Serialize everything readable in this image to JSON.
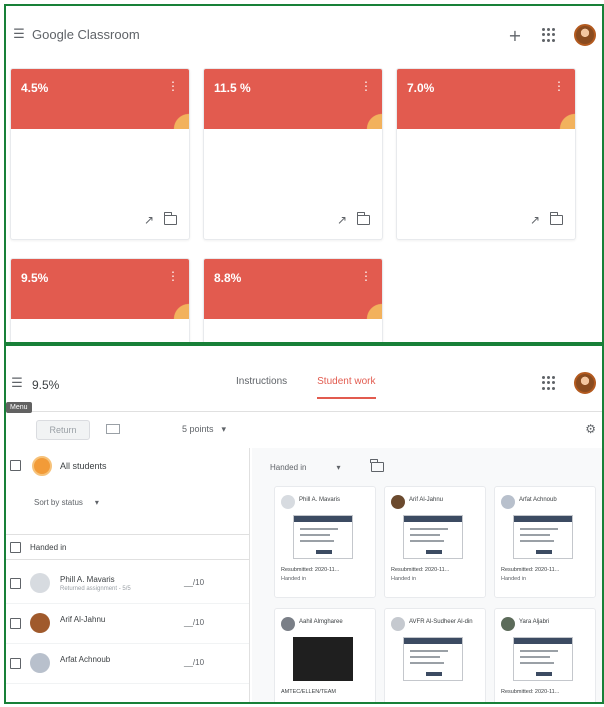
{
  "top": {
    "brand": "Google Classroom",
    "icons": {
      "menu": "menu-icon",
      "add": "plus-icon",
      "apps": "apps-icon"
    },
    "cards": [
      {
        "title": "4.5%",
        "more": "⋮"
      },
      {
        "title": "11.5 %",
        "more": "⋮"
      },
      {
        "title": "7.0%",
        "more": "⋮"
      },
      {
        "title": "9.5%",
        "more": "⋮"
      },
      {
        "title": "8.8%",
        "more": "⋮"
      }
    ]
  },
  "bottom": {
    "class_name": "9.5%",
    "tooltip": "Menu",
    "tabs": [
      {
        "label": "Instructions",
        "active": false
      },
      {
        "label": "Student work",
        "active": true
      }
    ],
    "toolbar": {
      "return_label": "Return",
      "points_label": "5 points",
      "points_caret": "▾"
    },
    "list": {
      "all_students": "All students",
      "sort_label": "Sort by status",
      "sort_caret": "▾",
      "group_label": "Handed in",
      "students": [
        {
          "name": "Phill A. Mavaris",
          "sub": "Returned assignment - 5/5",
          "grade": "__/10"
        },
        {
          "name": "Arif Al-Jahnu",
          "sub": "",
          "grade": "__/10"
        },
        {
          "name": "Arfat Achnoub",
          "sub": "",
          "grade": "__/10"
        }
      ]
    },
    "work": {
      "filter_label": "Handed in",
      "filter_caret": "▾",
      "cards": [
        {
          "name": "Phill A. Mavaris",
          "status": "Resubmitted: 2020-11...",
          "sub": "Handed in",
          "thumb": "form"
        },
        {
          "name": "Arif Al-Jahnu",
          "status": "Resubmitted: 2020-11...",
          "sub": "Handed in",
          "thumb": "form"
        },
        {
          "name": "Arfat Achnoub",
          "status": "Resubmitted: 2020-11...",
          "sub": "Handed in",
          "thumb": "form"
        },
        {
          "name": "Aahil Almgharee",
          "status": "AMTEC/ELLEN/TEAM",
          "sub": "",
          "thumb": "dark"
        },
        {
          "name": "AVFR Al-Sudheer Al-din",
          "status": "",
          "sub": "",
          "thumb": "form"
        },
        {
          "name": "Yara Aljabri",
          "status": "Resubmitted: 2020-11...",
          "sub": "",
          "thumb": "form"
        }
      ]
    }
  },
  "colors": {
    "card_header": "#e25b4f",
    "accent": "#e25b4f",
    "frame": "#188038"
  }
}
